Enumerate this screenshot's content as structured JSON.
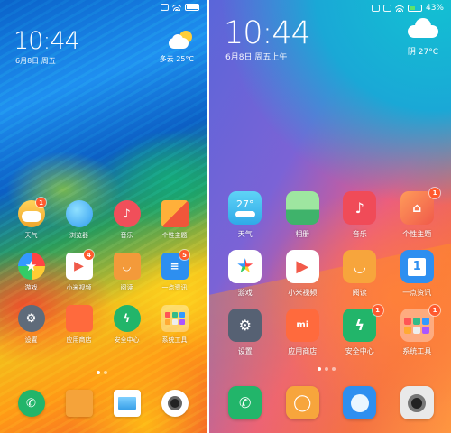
{
  "left_screen": {
    "clock": "10:44",
    "date": "6月8日 周五",
    "weather": {
      "text": "多云 25°C",
      "icon": "partly-cloudy-icon"
    },
    "badges_row1": {
      "weather": "1"
    },
    "apps": [
      {
        "label": "天气",
        "icon": "weather-icon",
        "bg": "#f2b431",
        "badge": "1"
      },
      {
        "label": "浏览器",
        "icon": "browser-icon",
        "bg": "#3aa8f0",
        "badge": ""
      },
      {
        "label": "音乐",
        "icon": "music-icon",
        "bg": "#f04f5a",
        "badge": ""
      },
      {
        "label": "个性主题",
        "icon": "theme-icon",
        "bg": "#f07a3a",
        "badge": ""
      },
      {
        "label": "游戏",
        "icon": "game-star-icon",
        "bg": "#ffffff",
        "badge": ""
      },
      {
        "label": "小米视频",
        "icon": "video-play-icon",
        "bg": "#ffffff",
        "badge": "4"
      },
      {
        "label": "阅读",
        "icon": "reader-smile-icon",
        "bg": "#f39a3a",
        "badge": ""
      },
      {
        "label": "一点资讯",
        "icon": "news-icon",
        "bg": "#2d8ff0",
        "badge": "5"
      },
      {
        "label": "设置",
        "icon": "gear-icon",
        "bg": "#5f6b7a",
        "badge": ""
      },
      {
        "label": "应用商店",
        "icon": "store-bag-icon",
        "bg": "#ff6a3d",
        "badge": ""
      },
      {
        "label": "安全中心",
        "icon": "shield-icon",
        "bg": "#22b56a",
        "badge": ""
      },
      {
        "label": "系统工具",
        "icon": "tools-folder-icon",
        "bg": "#f0a33a",
        "badge": ""
      }
    ],
    "dock": [
      {
        "icon": "phone-icon",
        "bg": "#22b56a"
      },
      {
        "icon": "message-icon",
        "bg": "#f5a33a"
      },
      {
        "icon": "gallery-icon",
        "bg": "#ffffff"
      },
      {
        "icon": "camera-icon",
        "bg": "#ffffff"
      }
    ]
  },
  "right_screen": {
    "status": {
      "battery": "43%"
    },
    "clock": "10:44",
    "date": "6月8日 周五上午",
    "weather": {
      "text": "阴  27°C",
      "icon": "cloud-icon"
    },
    "apps": [
      {
        "label": "天气",
        "icon": "weather-27-icon",
        "bg": "#3fc1f0",
        "glyph": "27°",
        "badge": ""
      },
      {
        "label": "相册",
        "icon": "photos-icon",
        "bg": "#6fd08a",
        "glyph": "",
        "badge": ""
      },
      {
        "label": "音乐",
        "icon": "music-icon",
        "bg": "#f04b58",
        "glyph": "♪",
        "badge": ""
      },
      {
        "label": "个性主题",
        "icon": "theme-brush-icon",
        "bg": "#f27a4c",
        "glyph": "",
        "badge": "1"
      },
      {
        "label": "游戏",
        "icon": "game-star-icon",
        "bg": "#ffffff",
        "glyph": "★",
        "badge": ""
      },
      {
        "label": "小米视频",
        "icon": "video-play-icon",
        "bg": "#ffffff",
        "glyph": "▶",
        "badge": ""
      },
      {
        "label": "阅读",
        "icon": "reader-smile-icon",
        "bg": "#f7a53c",
        "glyph": "",
        "badge": ""
      },
      {
        "label": "一点资讯",
        "icon": "news-1-icon",
        "bg": "#2e8ff0",
        "glyph": "1",
        "badge": ""
      },
      {
        "label": "设置",
        "icon": "gear-icon",
        "bg": "#566173",
        "glyph": "⚙",
        "badge": ""
      },
      {
        "label": "应用商店",
        "icon": "store-bag-icon",
        "bg": "#ff6a3d",
        "glyph": "mi",
        "badge": ""
      },
      {
        "label": "安全中心",
        "icon": "shield-icon",
        "bg": "#22b56a",
        "glyph": "",
        "badge": "1"
      },
      {
        "label": "系统工具",
        "icon": "tools-folder-icon",
        "bg": "#e96b43",
        "glyph": "",
        "badge": "1"
      }
    ],
    "dock": [
      {
        "icon": "phone-icon",
        "bg": "#22b56a"
      },
      {
        "icon": "message-icon",
        "bg": "#f7a53c"
      },
      {
        "icon": "browser-icon",
        "bg": "#2e8ff0"
      },
      {
        "icon": "camera-icon",
        "bg": "#e9e9e9"
      }
    ]
  }
}
